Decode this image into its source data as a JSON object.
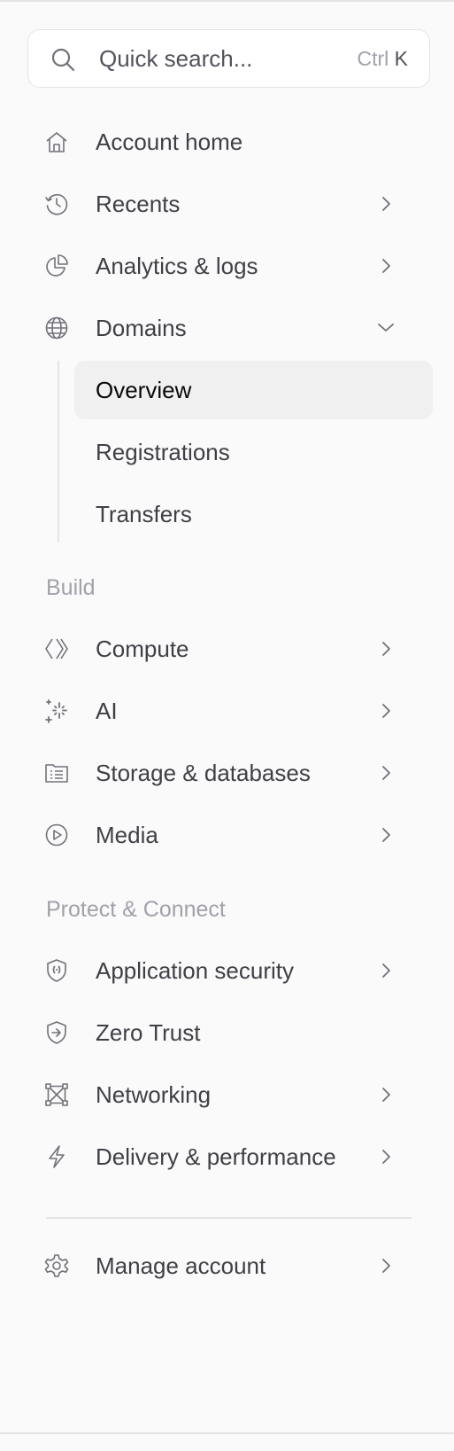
{
  "search": {
    "placeholder": "Quick search...",
    "shortcut_mod": "Ctrl",
    "shortcut_key": "K"
  },
  "nav": {
    "account_home": {
      "label": "Account home",
      "icon": "home-icon"
    },
    "recents": {
      "label": "Recents",
      "icon": "history-icon"
    },
    "analytics": {
      "label": "Analytics & logs",
      "icon": "pie-chart-icon"
    },
    "domains": {
      "label": "Domains",
      "icon": "globe-icon",
      "expanded": true,
      "children": [
        {
          "label": "Overview",
          "active": true
        },
        {
          "label": "Registrations"
        },
        {
          "label": "Transfers"
        }
      ]
    }
  },
  "sections": {
    "build": {
      "title": "Build",
      "items": [
        {
          "label": "Compute",
          "icon": "compute-icon"
        },
        {
          "label": "AI",
          "icon": "sparkle-icon"
        },
        {
          "label": "Storage & databases",
          "icon": "database-icon"
        },
        {
          "label": "Media",
          "icon": "play-icon"
        }
      ]
    },
    "protect": {
      "title": "Protect & Connect",
      "items": [
        {
          "label": "Application security",
          "icon": "shield-icon"
        },
        {
          "label": "Zero Trust",
          "icon": "shield-arrow-icon"
        },
        {
          "label": "Networking",
          "icon": "network-icon"
        },
        {
          "label": "Delivery & performance",
          "icon": "bolt-icon"
        }
      ]
    }
  },
  "footer": {
    "manage_account": {
      "label": "Manage account",
      "icon": "gear-icon"
    }
  },
  "colors": {
    "background": "#fafafa",
    "text": "#3f3f46",
    "muted": "#a1a1aa",
    "active_bg": "#f0f0f0",
    "border": "#e4e4e7"
  }
}
